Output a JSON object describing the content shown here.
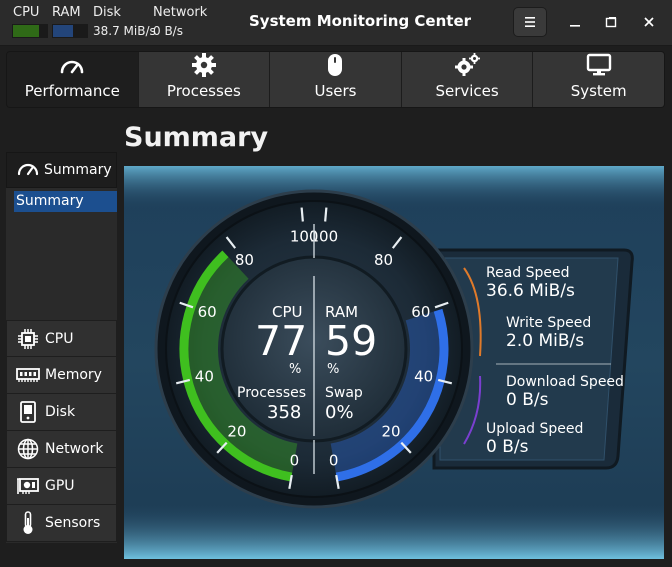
{
  "titlebar": {
    "cpu_label": "CPU",
    "ram_label": "RAM",
    "disk_label": "Disk",
    "network_label": "Network",
    "disk_speed": "38.7 MiB/s",
    "network_speed": "0 B/s",
    "app_title": "System Monitoring Center",
    "cpu_percent": 77,
    "ram_percent": 59
  },
  "main_tabs": [
    {
      "label": "Performance",
      "icon": "gauge-icon"
    },
    {
      "label": "Processes",
      "icon": "gear-icon"
    },
    {
      "label": "Users",
      "icon": "mouse-icon"
    },
    {
      "label": "Services",
      "icon": "gears-icon"
    },
    {
      "label": "System",
      "icon": "monitor-icon"
    }
  ],
  "sidebar": {
    "header": "Summary",
    "selected": "Summary",
    "items": [
      {
        "label": "CPU",
        "icon": "cpu-icon"
      },
      {
        "label": "Memory",
        "icon": "memory-icon"
      },
      {
        "label": "Disk",
        "icon": "disk-icon"
      },
      {
        "label": "Network",
        "icon": "network-icon"
      },
      {
        "label": "GPU",
        "icon": "gpu-icon"
      },
      {
        "label": "Sensors",
        "icon": "thermometer-icon"
      }
    ]
  },
  "page_heading": "Summary",
  "gauge": {
    "cpu_label": "CPU",
    "cpu_value": "77",
    "cpu_unit": "%",
    "ram_label": "RAM",
    "ram_value": "59",
    "ram_unit": "%",
    "processes_label": "Processes",
    "processes_value": "358",
    "swap_label": "Swap",
    "swap_value": "0%",
    "left_ticks": [
      "0",
      "20",
      "40",
      "60",
      "80",
      "100"
    ],
    "right_ticks": [
      "0",
      "20",
      "40",
      "60",
      "80",
      "100"
    ],
    "cpu_level": 0.77,
    "ram_level": 0.59
  },
  "disk_net": {
    "read_label": "Read Speed",
    "read_value": "36.6 MiB/s",
    "write_label": "Write Speed",
    "write_value": "2.0 MiB/s",
    "download_label": "Download Speed",
    "download_value": "0 B/s",
    "upload_label": "Upload Speed",
    "upload_value": "0 B/s"
  },
  "colors": {
    "cpu_arc": "#3fbf1f",
    "ram_arc": "#2f6fe8",
    "selection": "#1c4f8f",
    "read_arc": "#e07a2a",
    "net_arc": "#7a3fd0"
  }
}
